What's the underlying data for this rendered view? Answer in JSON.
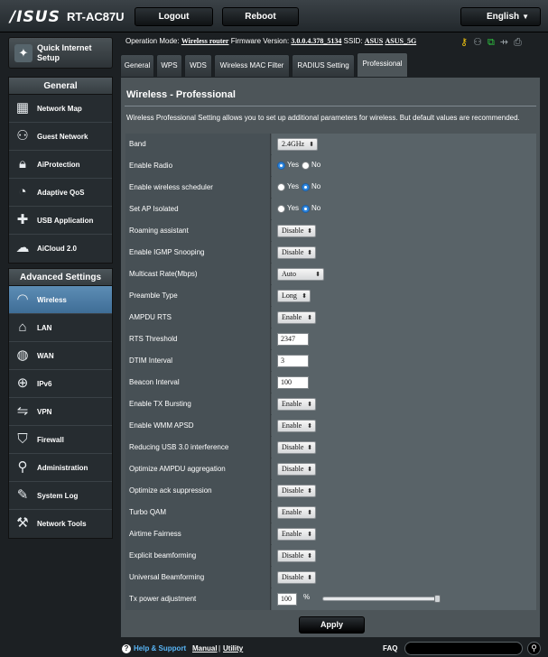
{
  "header": {
    "logo": "/ISUS",
    "model": "RT-AC87U",
    "logout_label": "Logout",
    "reboot_label": "Reboot",
    "language": "English"
  },
  "sidebar": {
    "quick_setup": "Quick Internet Setup",
    "general_title": "General",
    "general_items": [
      {
        "label": "Network Map",
        "icon": "network-map-icon"
      },
      {
        "label": "Guest Network",
        "icon": "guest-network-icon"
      },
      {
        "label": "AiProtection",
        "icon": "lock-icon"
      },
      {
        "label": "Adaptive QoS",
        "icon": "gauge-icon"
      },
      {
        "label": "USB Application",
        "icon": "puzzle-icon"
      },
      {
        "label": "AiCloud 2.0",
        "icon": "cloud-icon"
      }
    ],
    "advanced_title": "Advanced Settings",
    "advanced_items": [
      {
        "label": "Wireless",
        "icon": "wifi-icon",
        "active": true
      },
      {
        "label": "LAN",
        "icon": "home-icon"
      },
      {
        "label": "WAN",
        "icon": "globe-icon"
      },
      {
        "label": "IPv6",
        "icon": "ipv6-icon"
      },
      {
        "label": "VPN",
        "icon": "vpn-icon"
      },
      {
        "label": "Firewall",
        "icon": "shield-icon"
      },
      {
        "label": "Administration",
        "icon": "user-icon"
      },
      {
        "label": "System Log",
        "icon": "log-icon"
      },
      {
        "label": "Network Tools",
        "icon": "tools-icon"
      }
    ]
  },
  "status": {
    "opmode_label": "Operation Mode:",
    "opmode_value": "Wireless router",
    "fw_label": "Firmware Version:",
    "fw_value": "3.0.0.4.378_5134",
    "ssid_label": "SSID:",
    "ssid_1": "ASUS",
    "ssid_2": "ASUS_5G"
  },
  "tabs": [
    "General",
    "WPS",
    "WDS",
    "Wireless MAC Filter",
    "RADIUS Setting",
    "Professional"
  ],
  "panel": {
    "title": "Wireless - Professional",
    "description": "Wireless Professional Setting allows you to set up additional parameters for wireless. But default values are recommended."
  },
  "settings": {
    "band": {
      "label": "Band",
      "value": "2.4GHz"
    },
    "enable_radio": {
      "label": "Enable Radio",
      "yes": "Yes",
      "no": "No",
      "selected": "Yes"
    },
    "enable_scheduler": {
      "label": "Enable wireless scheduler",
      "yes": "Yes",
      "no": "No",
      "selected": "No"
    },
    "set_ap_isolated": {
      "label": "Set AP Isolated",
      "yes": "Yes",
      "no": "No",
      "selected": "No"
    },
    "roaming_assistant": {
      "label": "Roaming assistant",
      "value": "Disable"
    },
    "igmp_snooping": {
      "label": "Enable IGMP Snooping",
      "value": "Disable"
    },
    "multicast_rate": {
      "label": "Multicast Rate(Mbps)",
      "value": "Auto"
    },
    "preamble_type": {
      "label": "Preamble Type",
      "value": "Long"
    },
    "ampdu_rts": {
      "label": "AMPDU RTS",
      "value": "Enable"
    },
    "rts_threshold": {
      "label": "RTS Threshold",
      "value": "2347"
    },
    "dtim_interval": {
      "label": "DTIM Interval",
      "value": "3"
    },
    "beacon_interval": {
      "label": "Beacon Interval",
      "value": "100"
    },
    "tx_bursting": {
      "label": "Enable TX Bursting",
      "value": "Enable"
    },
    "wmm_apsd": {
      "label": "Enable WMM APSD",
      "value": "Enable"
    },
    "usb3_interference": {
      "label": "Reducing USB 3.0 interference",
      "value": "Disable"
    },
    "ampdu_aggregation": {
      "label": "Optimize AMPDU aggregation",
      "value": "Disable"
    },
    "ack_suppression": {
      "label": "Optimize ack suppression",
      "value": "Disable"
    },
    "turbo_qam": {
      "label": "Turbo QAM",
      "value": "Enable"
    },
    "airtime_fairness": {
      "label": "Airtime Fairness",
      "value": "Enable"
    },
    "explicit_beamforming": {
      "label": "Explicit beamforming",
      "value": "Disable"
    },
    "universal_beamforming": {
      "label": "Universal Beamforming",
      "value": "Disable"
    },
    "tx_power": {
      "label": "Tx power adjustment",
      "value": "100",
      "unit": "%",
      "slider_fraction": 1.0
    }
  },
  "apply_label": "Apply",
  "footer": {
    "help": "Help & Support",
    "manual": "Manual",
    "separator": "|",
    "utility": "Utility",
    "faq": "FAQ"
  }
}
